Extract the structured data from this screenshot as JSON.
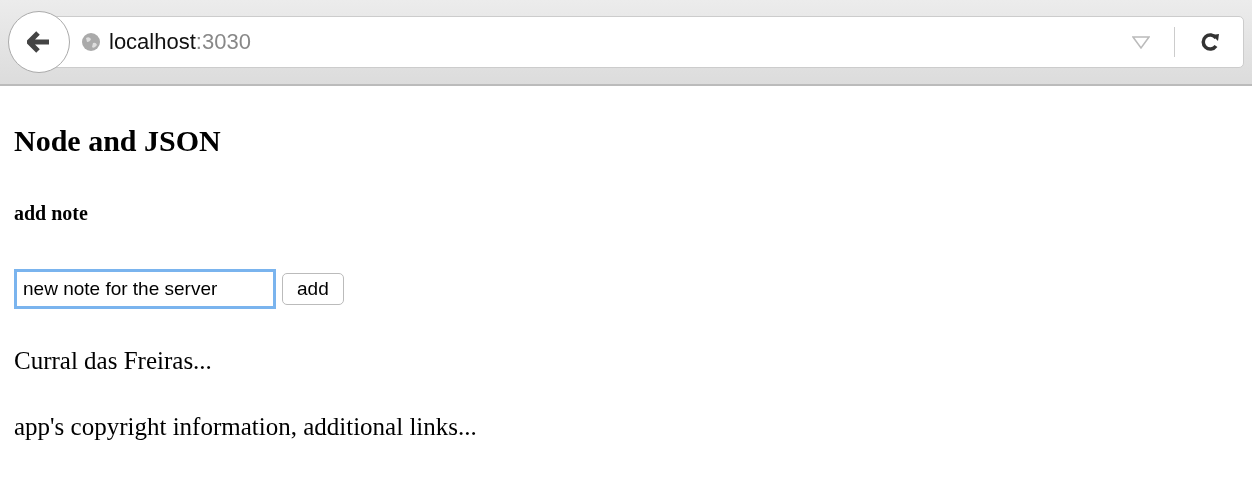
{
  "browser": {
    "url_host": "localhost",
    "url_port": ":3030"
  },
  "page": {
    "title": "Node and JSON",
    "subtitle": "add note",
    "form": {
      "value": "new note for the server",
      "focused": true,
      "button": "add"
    },
    "notes": [
      "Curral das Freiras..."
    ],
    "footer": "app's copyright information, additional links..."
  }
}
